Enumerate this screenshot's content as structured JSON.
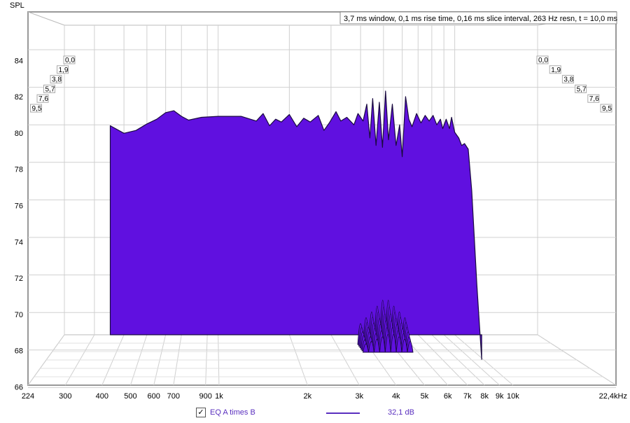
{
  "chart_data": {
    "type": "area",
    "ylabel": "SPL",
    "yticks": [
      "66",
      "68",
      "70",
      "72",
      "74",
      "76",
      "78",
      "80",
      "82",
      "84"
    ],
    "ylim": [
      65,
      85
    ],
    "xticks": [
      "224",
      "300",
      "400",
      "500",
      "600",
      "700",
      "900",
      "1k",
      "2k",
      "3k",
      "4k",
      "5k",
      "6k",
      "7k",
      "8k",
      "9k",
      "10k",
      "22,4kHz"
    ],
    "xtick_values": [
      224,
      300,
      400,
      500,
      600,
      700,
      900,
      1000,
      2000,
      3000,
      4000,
      5000,
      6000,
      7000,
      8000,
      9000,
      10000,
      22400
    ],
    "xlim": [
      224,
      22400
    ],
    "xscale": "log",
    "depth_labels": [
      "0,0",
      "1,9",
      "3,8",
      "5,7",
      "7,6",
      "9,5"
    ],
    "depth_unit": "ms",
    "info_text": "3,7 ms window, 0,1 ms rise time, 0,16 ms slice interval, 263 Hz resn, t = 10,0 ms",
    "fill_color": "#6010e0",
    "front_slice": [
      [
        350,
        79.95
      ],
      [
        400,
        79.55
      ],
      [
        450,
        79.7
      ],
      [
        500,
        80.05
      ],
      [
        550,
        80.3
      ],
      [
        600,
        80.65
      ],
      [
        650,
        80.75
      ],
      [
        700,
        80.45
      ],
      [
        750,
        80.25
      ],
      [
        850,
        80.4
      ],
      [
        1000,
        80.45
      ],
      [
        1250,
        80.45
      ],
      [
        1450,
        80.2
      ],
      [
        1550,
        80.6
      ],
      [
        1650,
        79.95
      ],
      [
        1750,
        80.3
      ],
      [
        1850,
        80.15
      ],
      [
        2000,
        80.55
      ],
      [
        2150,
        79.9
      ],
      [
        2300,
        80.35
      ],
      [
        2450,
        80.15
      ],
      [
        2650,
        80.5
      ],
      [
        2800,
        79.7
      ],
      [
        2950,
        80.1
      ],
      [
        3150,
        80.7
      ],
      [
        3300,
        80.2
      ],
      [
        3500,
        80.4
      ],
      [
        3750,
        80.0
      ],
      [
        3900,
        80.6
      ],
      [
        4100,
        80.2
      ],
      [
        4250,
        81.1
      ],
      [
        4380,
        79.3
      ],
      [
        4500,
        81.4
      ],
      [
        4650,
        78.9
      ],
      [
        4800,
        81.2
      ],
      [
        4950,
        78.8
      ],
      [
        5100,
        81.8
      ],
      [
        5250,
        79.2
      ],
      [
        5450,
        81.1
      ],
      [
        5650,
        78.9
      ],
      [
        5850,
        80.0
      ],
      [
        6000,
        78.3
      ],
      [
        6200,
        81.5
      ],
      [
        6400,
        80.3
      ],
      [
        6600,
        79.9
      ],
      [
        6900,
        80.6
      ],
      [
        7200,
        80.1
      ],
      [
        7500,
        80.5
      ],
      [
        7800,
        80.2
      ],
      [
        8100,
        80.5
      ],
      [
        8400,
        80.0
      ],
      [
        8700,
        80.3
      ],
      [
        8900,
        79.8
      ],
      [
        9200,
        80.3
      ],
      [
        9500,
        79.8
      ],
      [
        9700,
        80.4
      ],
      [
        10000,
        79.6
      ],
      [
        10400,
        79.3
      ],
      [
        10700,
        78.9
      ],
      [
        11000,
        79.0
      ],
      [
        11400,
        78.7
      ],
      [
        11800,
        76.5
      ],
      [
        12400,
        71.5
      ],
      [
        13000,
        67.5
      ]
    ],
    "peak_range_hz": [
      4000,
      6500
    ],
    "peak_max_spl": 72
  },
  "legend": {
    "checkbox_mark": "✓",
    "series_name": "EQ A times B",
    "series_color": "#5a2fbf",
    "value": "32,1 dB"
  }
}
